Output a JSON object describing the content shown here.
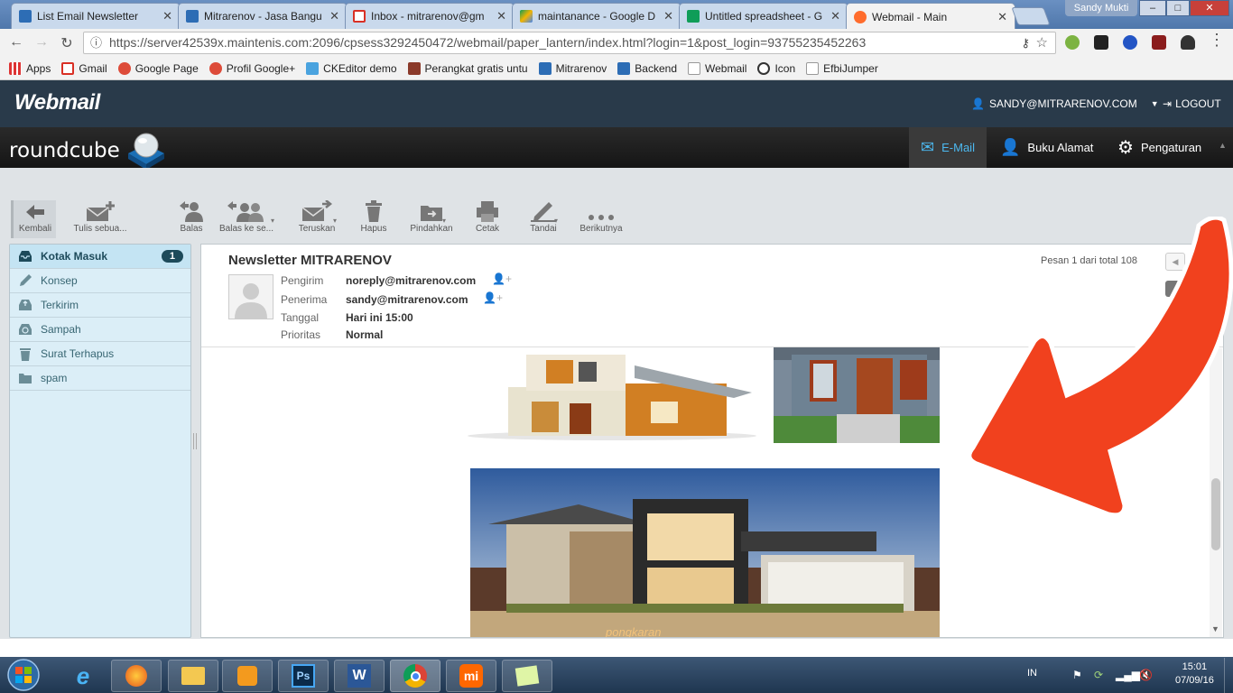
{
  "browser": {
    "tabs": [
      {
        "title": "List Email Newsletter",
        "color": "#2d6db5"
      },
      {
        "title": "Mitrarenov - Jasa Bangu",
        "color": "#2d6db5"
      },
      {
        "title": "Inbox - mitrarenov@gm",
        "color": "#d93025"
      },
      {
        "title": "maintanance - Google D",
        "color": "#f4b400"
      },
      {
        "title": "Untitled spreadsheet - G",
        "color": "#0f9d58"
      },
      {
        "title": "Webmail - Main",
        "color": "#ff6c2c"
      }
    ],
    "window_user": "Sandy Mukti",
    "url": "https://server42539x.maintenis.com:2096/cpsess3292450472/webmail/paper_lantern/index.html?login=1&post_login=93755235452263",
    "bookmarks": [
      {
        "label": "Apps",
        "color": "#d33"
      },
      {
        "label": "Gmail",
        "color": "#d93025"
      },
      {
        "label": "Google Page",
        "color": "#dd4b39"
      },
      {
        "label": "Profil Google+",
        "color": "#dd4b39"
      },
      {
        "label": "CKEditor demo",
        "color": "#4aa3df"
      },
      {
        "label": "Perangkat gratis untu",
        "color": "#8b3a2a"
      },
      {
        "label": "Mitrarenov",
        "color": "#2d6db5"
      },
      {
        "label": "Backend",
        "color": "#2d6db5"
      },
      {
        "label": "Webmail",
        "color": "#999"
      },
      {
        "label": "Icon",
        "color": "#333"
      },
      {
        "label": "EfbiJumper",
        "color": "#999"
      }
    ]
  },
  "webmail": {
    "logo": "Webmail",
    "user": "SANDY@MITRARENOV.COM",
    "logout": "LOGOUT"
  },
  "roundcube": {
    "logo": "roundcube",
    "nav": {
      "email": "E-Mail",
      "contacts": "Buku Alamat",
      "settings": "Pengaturan"
    }
  },
  "toolbar": {
    "back": "Kembali",
    "compose": "Tulis sebua...",
    "reply": "Balas",
    "reply_all": "Balas ke se...",
    "forward": "Teruskan",
    "delete": "Hapus",
    "move": "Pindahkan",
    "print": "Cetak",
    "mark": "Tandai",
    "more": "Berikutnya"
  },
  "folders": [
    {
      "label": "Kotak Masuk",
      "unread": "1",
      "icon": "inbox-icon"
    },
    {
      "label": "Konsep",
      "icon": "pencil-icon"
    },
    {
      "label": "Terkirim",
      "icon": "sent-icon"
    },
    {
      "label": "Sampah",
      "icon": "recycle-icon"
    },
    {
      "label": "Surat Terhapus",
      "icon": "trash-icon"
    },
    {
      "label": "spam",
      "icon": "folder-icon"
    }
  ],
  "message": {
    "subject": "Newsletter MITRARENOV",
    "counter": "Pesan 1 dari total 108",
    "labels": {
      "from": "Pengirim",
      "to": "Penerima",
      "date": "Tanggal",
      "priority": "Prioritas"
    },
    "from": "noreply@mitrarenov.com",
    "to": "sandy@mitrarenov.com",
    "date": "Hari ini 15:00",
    "priority": "Normal",
    "image_watermark": "pongkaran"
  },
  "taskbar": {
    "lang": "IN",
    "time": "15:01",
    "date": "07/09/16"
  }
}
